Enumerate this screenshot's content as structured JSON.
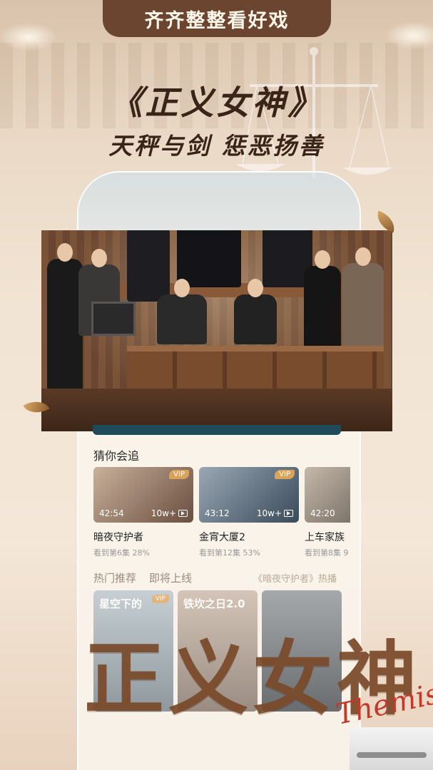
{
  "banner": {
    "text": "齐齐整整看好戏"
  },
  "hero": {
    "title": "《正义女神》",
    "subtitle": "天秤与剑 惩恶扬善"
  },
  "guess": {
    "section_title": "猜你会追",
    "cards": [
      {
        "badge": "VIP",
        "duration": "42:54",
        "plays": "10w+",
        "title": "暗夜守护者",
        "progress": "看到第6集 28%",
        "color": "#8a6a5a"
      },
      {
        "badge": "VIP",
        "duration": "43:12",
        "plays": "10w+",
        "title": "金宵大厦2",
        "progress": "看到第12集 53%",
        "color": "#6a7a8a"
      },
      {
        "badge": "",
        "duration": "42:20",
        "plays": "",
        "title": "上车家族",
        "progress": "看到第8集 9",
        "color": "#9a8a7a"
      }
    ]
  },
  "tabs": {
    "hot": "热门推荐",
    "upcoming": "即将上线",
    "promo": "《暗夜守护者》热播"
  },
  "recommend": [
    {
      "text": "星空下的",
      "badge": "VIP",
      "color": "#8a9aa8"
    },
    {
      "text": "铁坎之日2.0",
      "badge": "",
      "color": "#a8968a"
    },
    {
      "text": "",
      "badge": "",
      "color": "#6a7078"
    }
  ],
  "bottom": {
    "big_title": "正义女神",
    "signature": "Themis"
  }
}
